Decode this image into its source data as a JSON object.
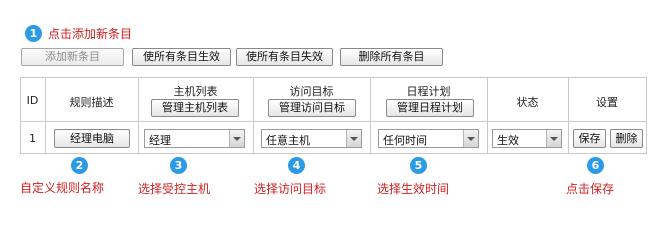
{
  "annotations": [
    {
      "number": "1",
      "text": "点击添加新条目"
    },
    {
      "number": "2",
      "text": "自定义规则名称"
    },
    {
      "number": "3",
      "text": "选择受控主机"
    },
    {
      "number": "4",
      "text": "选择访问目标"
    },
    {
      "number": "5",
      "text": "选择生效时间"
    },
    {
      "number": "6",
      "text": "点击保存"
    }
  ],
  "toolbar": {
    "add": "添加新条目",
    "enable_all": "使所有条目生效",
    "disable_all": "使所有条目失效",
    "delete_all": "删除所有条目"
  },
  "table": {
    "headers": {
      "id": "ID",
      "desc": "规则描述",
      "hosts": "主机列表",
      "hosts_btn": "管理主机列表",
      "target": "访问目标",
      "target_btn": "管理访问目标",
      "schedule": "日程计划",
      "schedule_btn": "管理日程计划",
      "status": "状态",
      "settings": "设置"
    },
    "row": {
      "id": "1",
      "desc_value": "经理电脑",
      "host_value": "经理",
      "target_value": "任意主机",
      "schedule_value": "任何时间",
      "status_value": "生效",
      "save": "保存",
      "delete": "删除"
    }
  },
  "colors": {
    "annotation_text": "#d42020",
    "badge": "#2b9be8",
    "grid": "#c9c9c9"
  }
}
